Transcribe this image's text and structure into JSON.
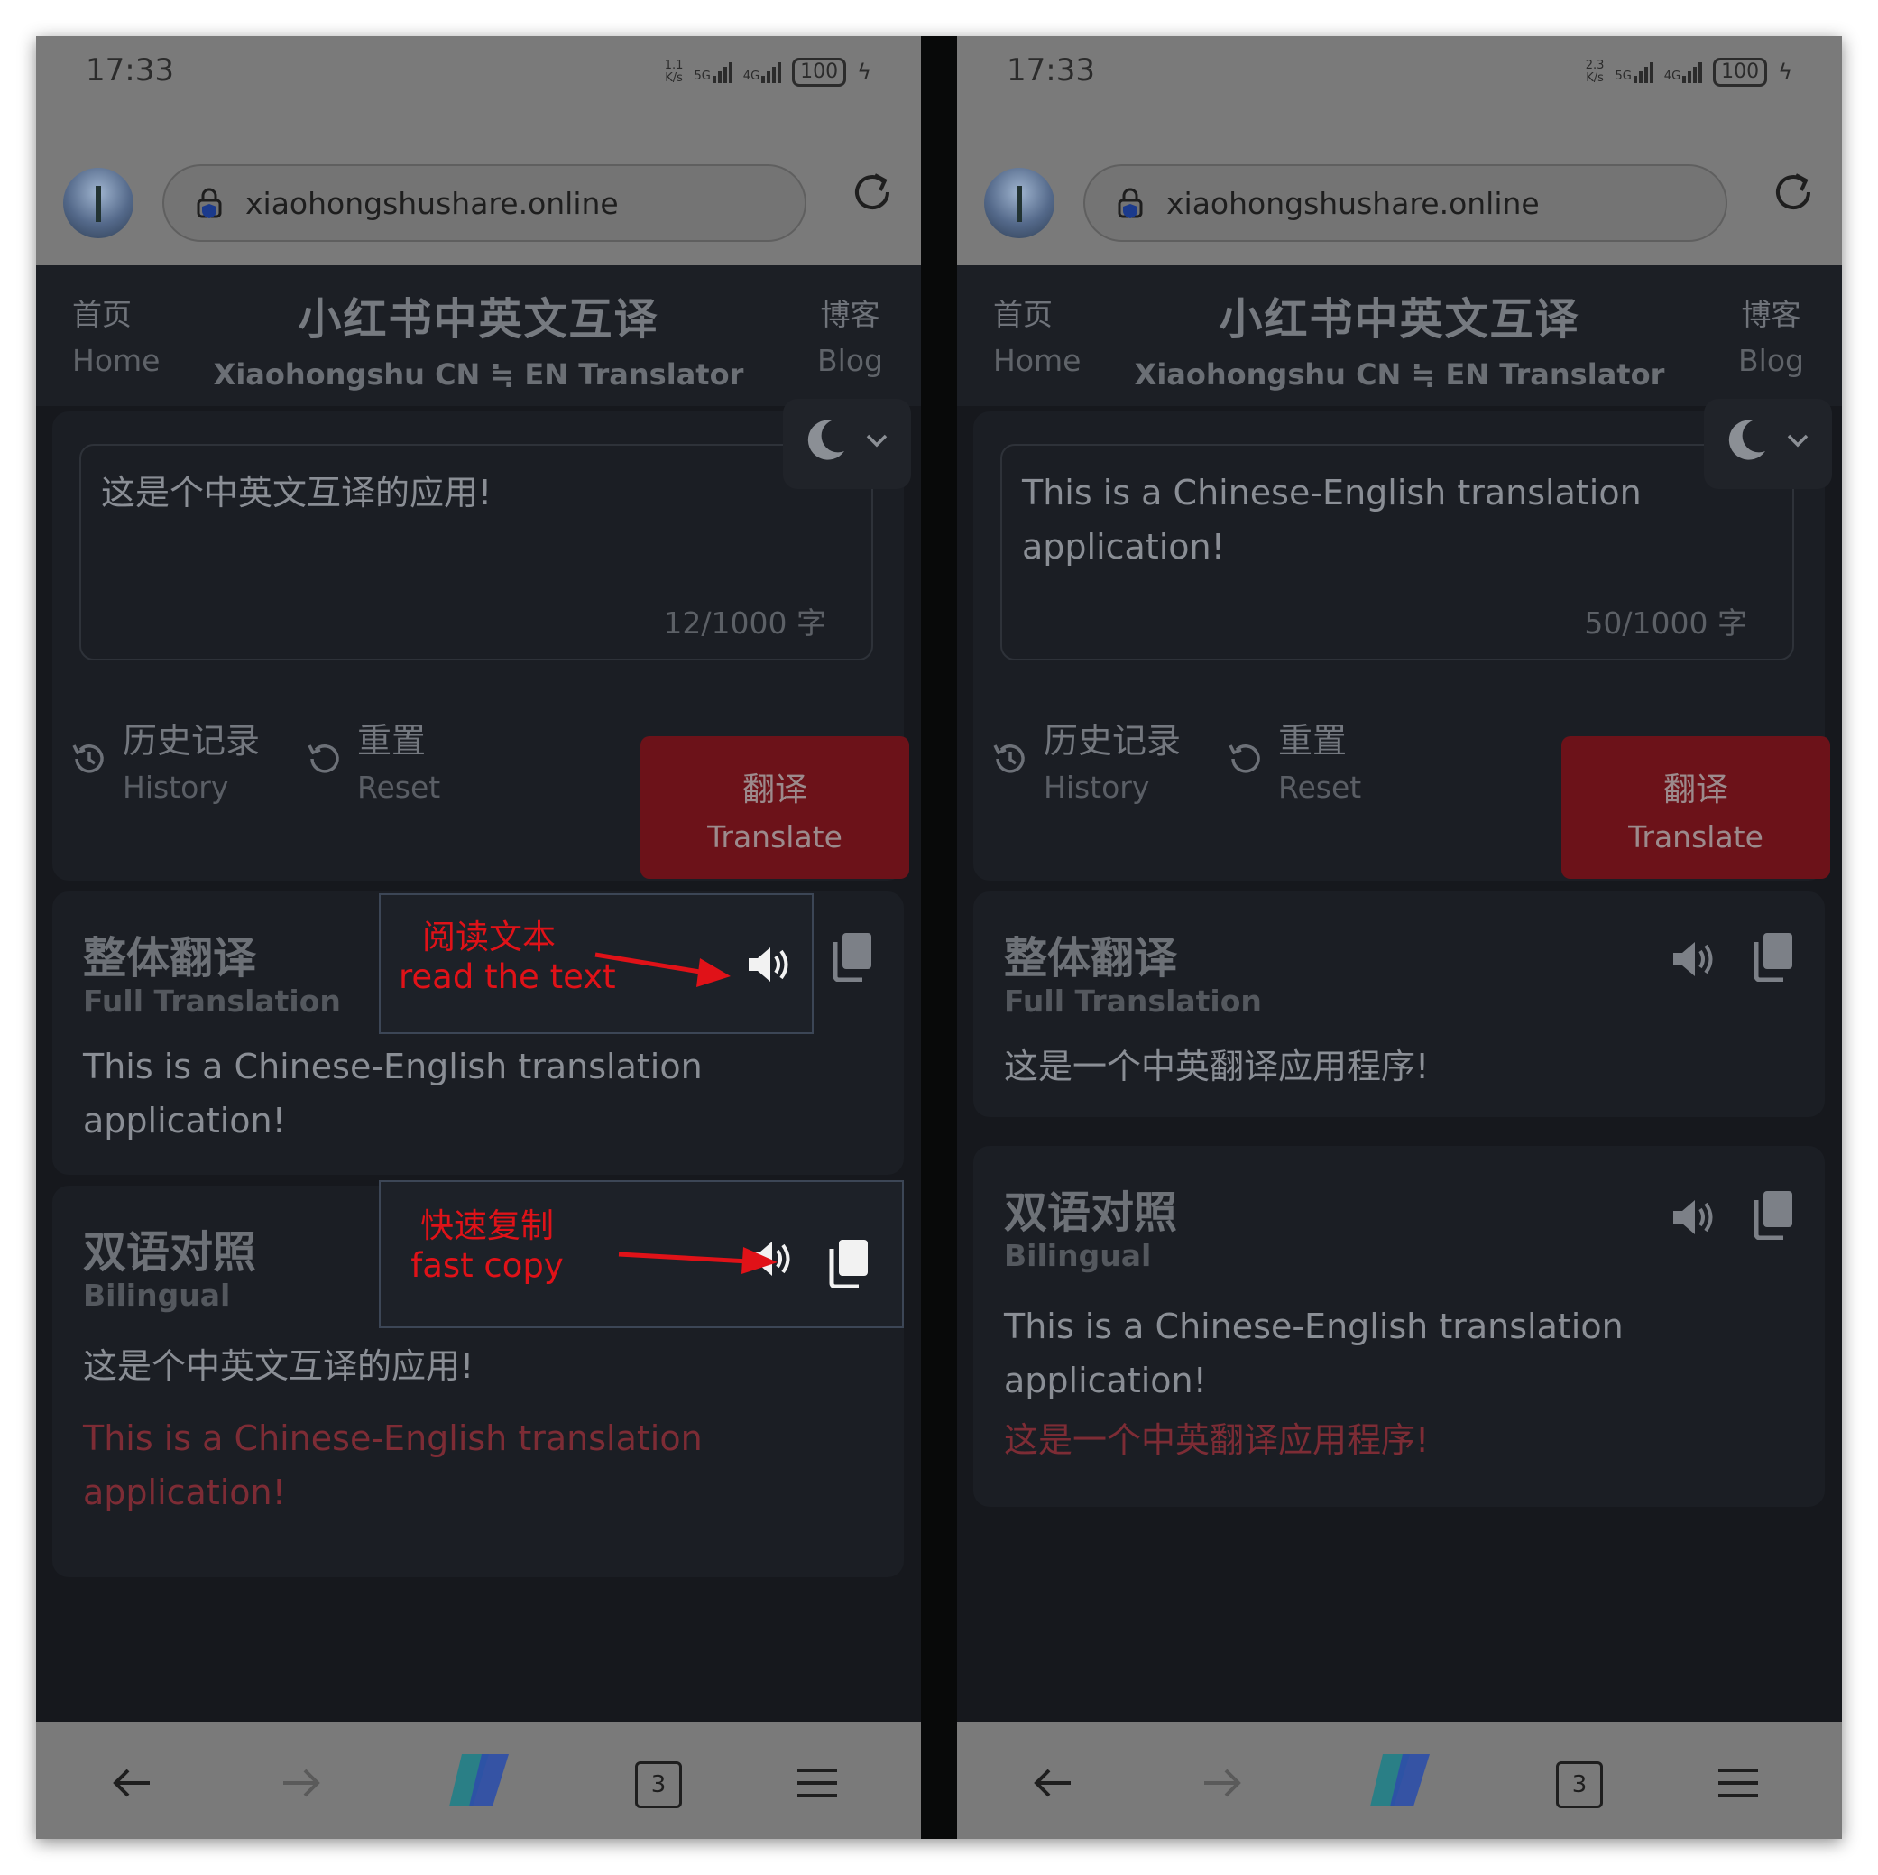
{
  "colors": {
    "accent_red": "#6c1219",
    "annotation_red": "#e01218",
    "background_dark": "#16181d"
  },
  "left": {
    "status": {
      "time": "17:33",
      "speed_value": "1.1",
      "speed_unit": "K/s",
      "net1": "5G",
      "net2": "4G",
      "battery": "100"
    },
    "browser": {
      "url": "xiaohongshushare.online",
      "tab_count": "3",
      "icons": [
        "back-icon",
        "forward-icon",
        "copilot-icon",
        "tabs-icon",
        "menu-icon"
      ]
    },
    "header": {
      "home_zh": "首页",
      "home_en": "Home",
      "title_zh": "小红书中英文互译",
      "title_en": "Xiaohongshu CN ≒ EN Translator",
      "blog_zh": "博客",
      "blog_en": "Blog"
    },
    "input": {
      "text": "这是个中英文互译的应用!",
      "counter": "12/1000 字"
    },
    "actions": {
      "history_zh": "历史记录",
      "history_en": "History",
      "reset_zh": "重置",
      "reset_en": "Reset",
      "translate_zh": "翻译",
      "translate_en": "Translate"
    },
    "full": {
      "title_zh": "整体翻译",
      "title_en": "Full Translation",
      "body": "This is a Chinese-English translation application!"
    },
    "bilingual": {
      "title_zh": "双语对照",
      "title_en": "Bilingual",
      "line1": "这是个中英文互译的应用!",
      "line2": "This is a Chinese-English translation application!"
    },
    "annotations": {
      "read_zh": "阅读文本",
      "read_en": "read the text",
      "copy_zh": "快速复制",
      "copy_en": "fast copy"
    }
  },
  "right": {
    "status": {
      "time": "17:33",
      "speed_value": "2.3",
      "speed_unit": "K/s",
      "net1": "5G",
      "net2": "4G",
      "battery": "100"
    },
    "browser": {
      "url": "xiaohongshushare.online",
      "tab_count": "3"
    },
    "header": {
      "home_zh": "首页",
      "home_en": "Home",
      "title_zh": "小红书中英文互译",
      "title_en": "Xiaohongshu CN ≒ EN Translator",
      "blog_zh": "博客",
      "blog_en": "Blog"
    },
    "input": {
      "text": "This is a Chinese-English translation application!",
      "counter": "50/1000 字"
    },
    "actions": {
      "history_zh": "历史记录",
      "history_en": "History",
      "reset_zh": "重置",
      "reset_en": "Reset",
      "translate_zh": "翻译",
      "translate_en": "Translate"
    },
    "full": {
      "title_zh": "整体翻译",
      "title_en": "Full Translation",
      "body": "这是一个中英翻译应用程序!"
    },
    "bilingual": {
      "title_zh": "双语对照",
      "title_en": "Bilingual",
      "line1": "This is a Chinese-English translation application!",
      "line2": "这是一个中英翻译应用程序!"
    }
  }
}
